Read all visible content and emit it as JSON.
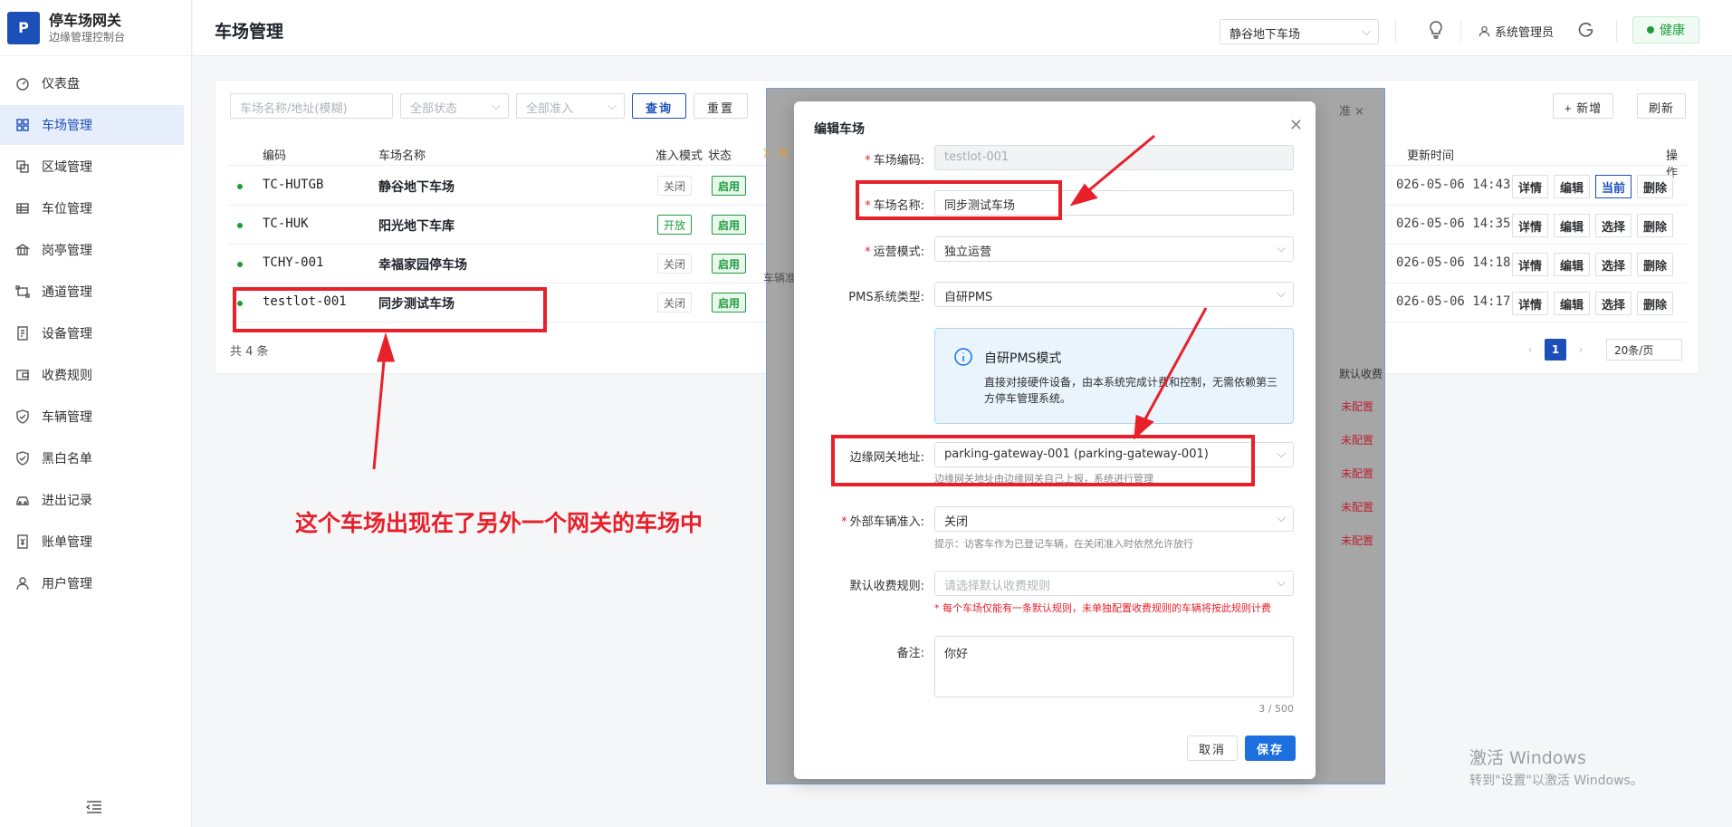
{
  "brand": {
    "logo": "P",
    "title": "停车场网关",
    "subtitle": "边缘管理控制台"
  },
  "sidebar": {
    "items": [
      {
        "label": "仪表盘",
        "icon": "dashboard-icon"
      },
      {
        "label": "车场管理",
        "icon": "grid-icon",
        "active": true
      },
      {
        "label": "区域管理",
        "icon": "area-icon"
      },
      {
        "label": "车位管理",
        "icon": "table-icon"
      },
      {
        "label": "岗亭管理",
        "icon": "bank-icon"
      },
      {
        "label": "通道管理",
        "icon": "channel-icon"
      },
      {
        "label": "设备管理",
        "icon": "device-icon"
      },
      {
        "label": "收费规则",
        "icon": "wallet-icon"
      },
      {
        "label": "车辆管理",
        "icon": "shield-icon"
      },
      {
        "label": "黑白名单",
        "icon": "shield-check-icon"
      },
      {
        "label": "进出记录",
        "icon": "car-icon"
      },
      {
        "label": "账单管理",
        "icon": "bill-icon"
      },
      {
        "label": "用户管理",
        "icon": "user-icon"
      }
    ]
  },
  "header": {
    "title": "车场管理",
    "lot_select": "静谷地下车场",
    "user": "系统管理员",
    "health": "健康"
  },
  "filters": {
    "name_placeholder": "车场名称/地址(模糊)",
    "status": "全部状态",
    "access": "全部准入",
    "query": "查询",
    "reset": "重置",
    "add": "+ 新增",
    "refresh": "刷新"
  },
  "table": {
    "columns": {
      "code": "编码",
      "name": "车场名称",
      "access": "准入模式",
      "status": "状态",
      "updated": "更新时间",
      "ops": "操作"
    },
    "rows": [
      {
        "code": "TC-HUTGB",
        "name": "静谷地下车场",
        "access": "关闭",
        "status": "启用",
        "updated": "026-05-06 14:43",
        "op3": "当前"
      },
      {
        "code": "TC-HUK",
        "name": "阳光地下车库",
        "access": "开放",
        "status": "启用",
        "updated": "026-05-06 14:35",
        "op3": "选择"
      },
      {
        "code": "TCHY-001",
        "name": "幸福家园停车场",
        "access": "关闭",
        "status": "启用",
        "updated": "026-05-06 14:18",
        "op3": "选择"
      },
      {
        "code": "testlot-001",
        "name": "同步测试车场",
        "access": "关闭",
        "status": "启用",
        "updated": "026-05-06 14:17",
        "op3": "选择"
      }
    ],
    "op_detail": "详情",
    "op_edit": "编辑",
    "op_delete": "删除",
    "total": "共 4 条",
    "page": "1",
    "page_size": "20条/页"
  },
  "bg_modal": {
    "tab_close": "准 ×",
    "left_frag1": "》 尚",
    "left_frag2": "车辆准",
    "col_header": "默认收费",
    "unset": "未配置"
  },
  "dialog": {
    "title": "编辑车场",
    "code_label": "车场编码:",
    "code_value": "testlot-001",
    "name_label": "车场名称:",
    "name_value": "同步测试车场",
    "mode_label": "运营模式:",
    "mode_value": "独立运营",
    "pms_label": "PMS系统类型:",
    "pms_value": "自研PMS",
    "info_title": "自研PMS模式",
    "info_text": "直接对接硬件设备，由本系统完成计费和控制，无需依赖第三方停车管理系统。",
    "gateway_label": "边缘网关地址:",
    "gateway_value": "parking-gateway-001 (parking-gateway-001)",
    "gateway_hint": "边缘网关地址由边缘网关自己上报，系统进行管理",
    "external_label": "外部车辆准入:",
    "external_value": "关闭",
    "external_hint": "提示：访客车作为已登记车辆，在关闭准入时依然允许放行",
    "rule_label": "默认收费规则:",
    "rule_placeholder": "请选择默认收费规则",
    "rule_hint": "* 每个车场仅能有一条默认规则，未单独配置收费规则的车辆将按此规则计费",
    "remark_label": "备注:",
    "remark_value": "你好",
    "counter": "3 / 500",
    "cancel": "取消",
    "save": "保存"
  },
  "annotation": {
    "text": "这个车场出现在了另外一个网关的车场中",
    "color": "#e8202a"
  },
  "watermark": {
    "line1": "激活 Windows",
    "line2": "转到\"设置\"以激活 Windows。"
  }
}
